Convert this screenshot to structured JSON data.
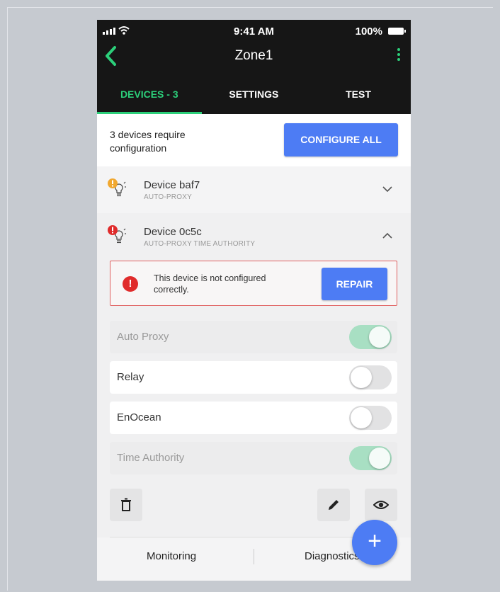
{
  "status": {
    "time": "9:41 AM",
    "battery": "100%"
  },
  "header": {
    "title": "Zone1"
  },
  "tabs": [
    {
      "label": "DEVICES - 3",
      "active": true
    },
    {
      "label": "SETTINGS",
      "active": false
    },
    {
      "label": "TEST",
      "active": false
    }
  ],
  "banner": {
    "text": "3 devices require configuration",
    "button": "CONFIGURE ALL"
  },
  "devices": [
    {
      "name": "Device baf7",
      "subtitle": "AUTO-PROXY",
      "status": "warning",
      "expanded": false
    },
    {
      "name": "Device 0c5c",
      "subtitle": "AUTO-PROXY  TIME AUTHORITY",
      "status": "error",
      "expanded": true
    }
  ],
  "alert": {
    "text": "This device is not configured correctly.",
    "button": "REPAIR"
  },
  "settings": [
    {
      "label": "Auto Proxy",
      "on": true,
      "disabled": true
    },
    {
      "label": "Relay",
      "on": false,
      "disabled": false
    },
    {
      "label": "EnOcean",
      "on": false,
      "disabled": false
    },
    {
      "label": "Time Authority",
      "on": true,
      "disabled": true
    }
  ],
  "actions": {
    "delete": "trash-icon",
    "edit": "pencil-icon",
    "view": "eye-icon"
  },
  "bottom_nav": {
    "monitoring": "Monitoring",
    "diagnostics": "Diagnostics"
  },
  "fab": {
    "label": "+"
  },
  "colors": {
    "accent_green": "#2ccf7a",
    "primary_blue": "#4d7cf4",
    "error_red": "#e02b2b",
    "header_bg": "#161616"
  }
}
